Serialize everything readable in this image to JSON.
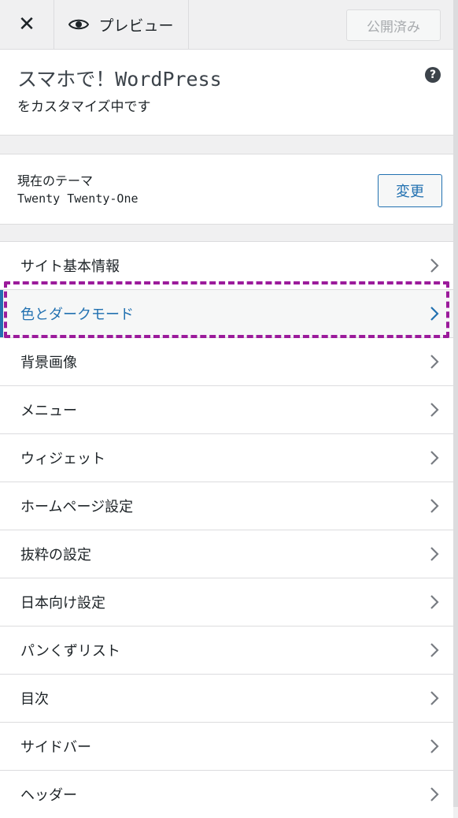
{
  "topbar": {
    "close_icon": "close-icon",
    "preview_label": "プレビュー",
    "preview_icon": "eye-icon",
    "publish_label": "公開済み"
  },
  "title_panel": {
    "title": "スマホで！WordPress",
    "subtitle": "をカスタマイズ中です",
    "help_icon": "question-icon",
    "help_glyph": "?"
  },
  "theme_panel": {
    "label": "現在のテーマ",
    "name": "Twenty Twenty-One",
    "change_label": "変更"
  },
  "menu": {
    "items": [
      {
        "label": "サイト基本情報"
      },
      {
        "label": "色とダークモード",
        "active": true
      },
      {
        "label": "背景画像"
      },
      {
        "label": "メニュー"
      },
      {
        "label": "ウィジェット"
      },
      {
        "label": "ホームページ設定"
      },
      {
        "label": "抜粋の設定"
      },
      {
        "label": "日本向け設定"
      },
      {
        "label": "パンくずリスト"
      },
      {
        "label": "目次"
      },
      {
        "label": "サイドバー"
      },
      {
        "label": "ヘッダー"
      }
    ]
  },
  "colors": {
    "accent": "#2271b1",
    "highlight_annotation": "#9b1b9b",
    "background": "#f0f0f1"
  }
}
